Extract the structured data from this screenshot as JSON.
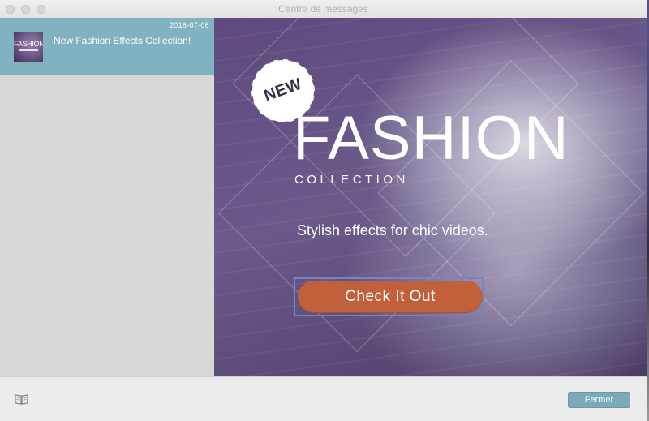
{
  "window": {
    "title": "Centre de messages"
  },
  "sidebar": {
    "messages": [
      {
        "date": "2016-07-06",
        "thumb_text": "FASHION",
        "title": "New Fashion Effects Collection!"
      }
    ]
  },
  "banner": {
    "badge": "NEW",
    "headline": "FASHION",
    "subhead": "COLLECTION",
    "tagline": "Stylish effects for chic videos.",
    "cta_label": "Check It Out"
  },
  "footer": {
    "left_icon": "book-icon",
    "close_label": "Fermer"
  },
  "colors": {
    "selected_item": "#80b2bf",
    "cta": "#c1603b",
    "close_button": "#7aa9b9"
  }
}
